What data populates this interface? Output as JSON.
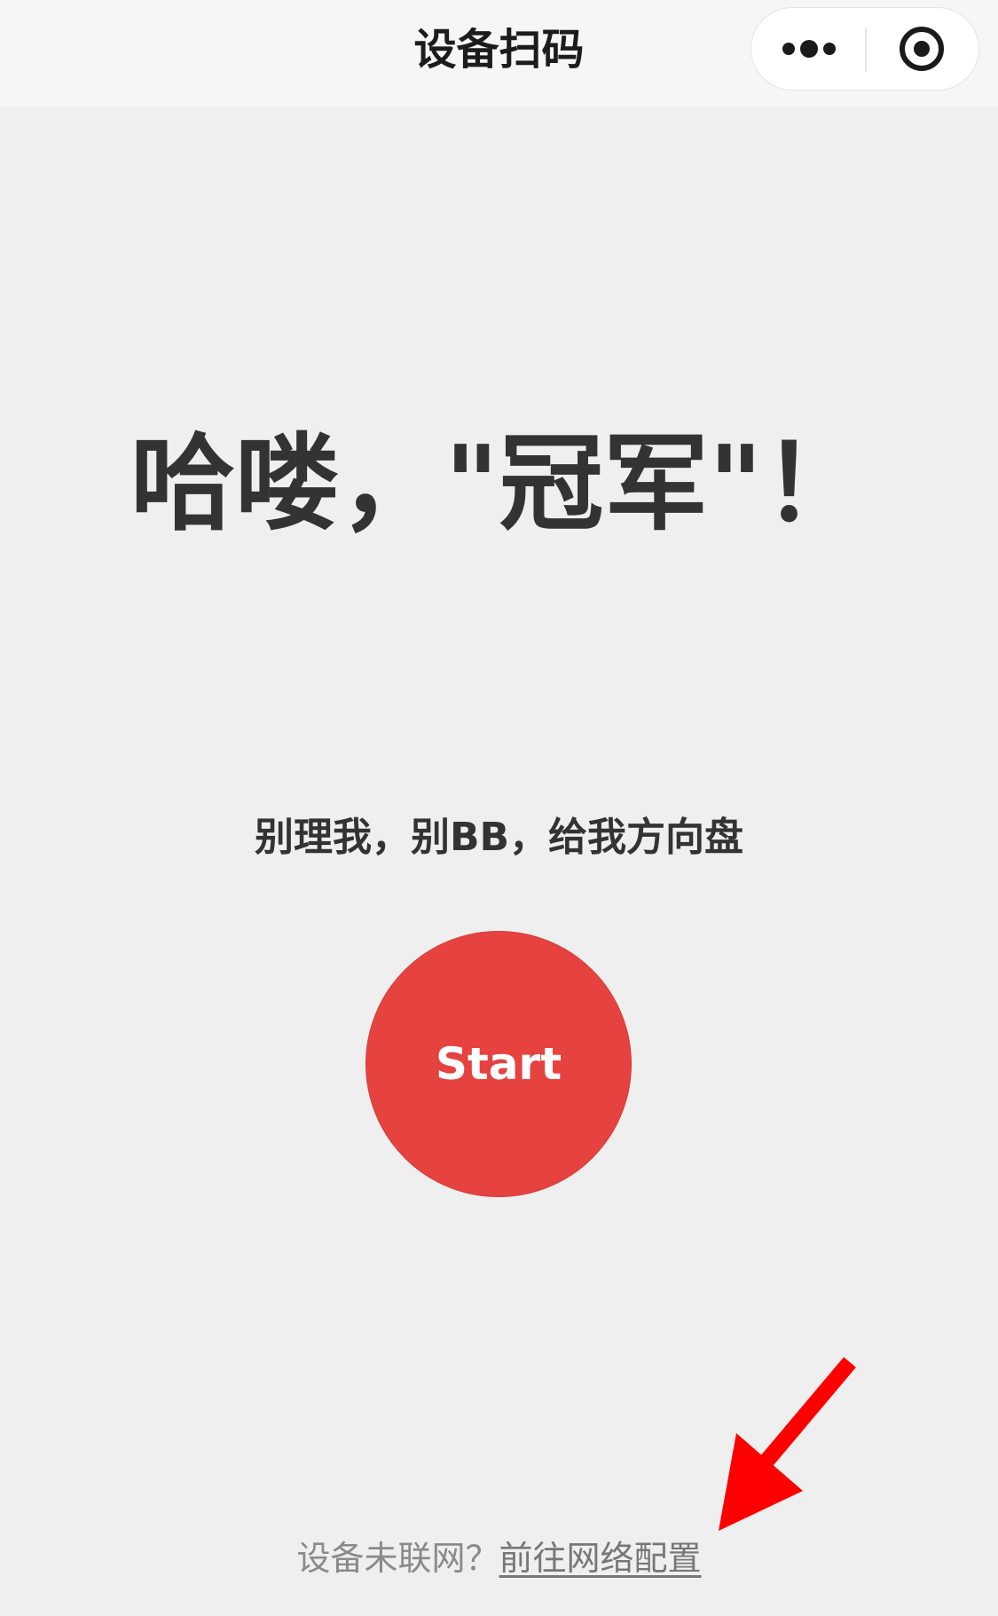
{
  "navbar": {
    "title": "设备扫码",
    "more_icon": "more-dots-icon",
    "close_icon": "target-circle-icon"
  },
  "main": {
    "greeting": "哈喽，\"冠军\"！",
    "subtitle": "别理我，别BB，给我方向盘",
    "start_label": "Start",
    "start_color": "#e64340"
  },
  "footer": {
    "prompt": "设备未联网？",
    "link_label": "前往网络配置"
  },
  "annotation": {
    "arrow_color": "#ff0000",
    "arrow_icon": "red-arrow-pointer"
  }
}
